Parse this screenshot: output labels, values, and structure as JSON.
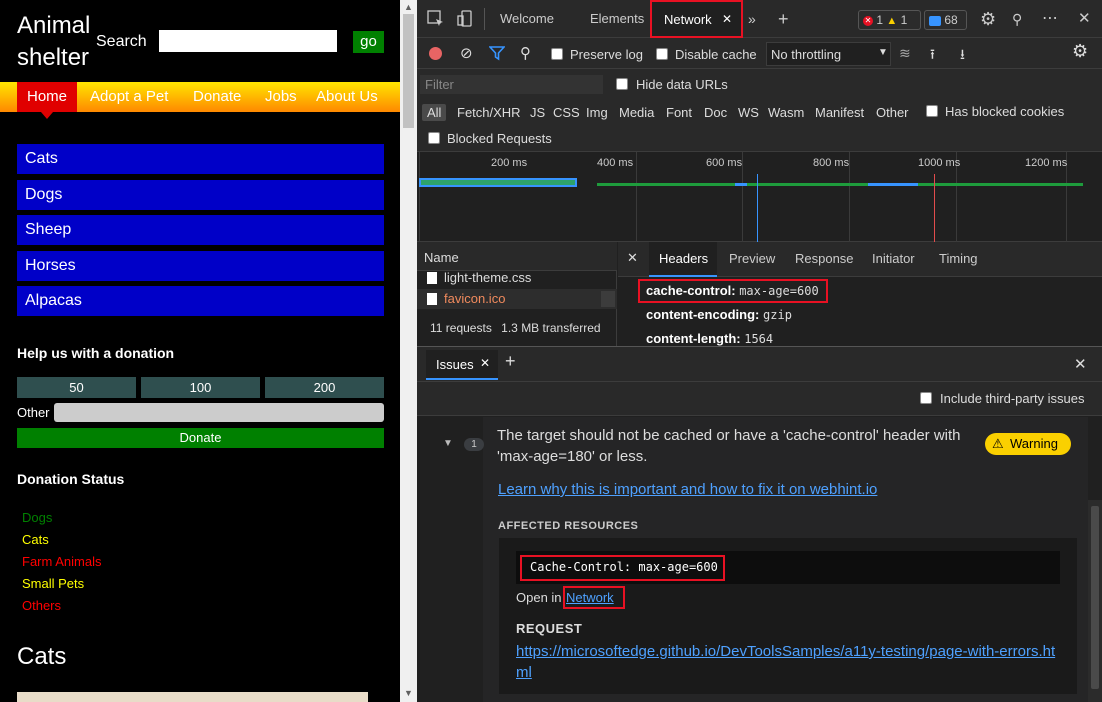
{
  "page": {
    "title": "Animal shelter",
    "search_label": "Search",
    "go_label": "go",
    "nav": [
      "Home",
      "Adopt a Pet",
      "Donate",
      "Jobs",
      "About Us"
    ],
    "animals": [
      "Cats",
      "Dogs",
      "Sheep",
      "Horses",
      "Alpacas"
    ],
    "donation_heading": "Help us with a donation",
    "amounts": [
      "50",
      "100",
      "200"
    ],
    "other_label": "Other",
    "donate_label": "Donate",
    "status_heading": "Donation Status",
    "status_items": [
      {
        "label": "Dogs",
        "color": "#008000"
      },
      {
        "label": "Cats",
        "color": "#ffff00"
      },
      {
        "label": "Farm Animals",
        "color": "#ff0000"
      },
      {
        "label": "Small Pets",
        "color": "#ffff00"
      },
      {
        "label": "Others",
        "color": "#ff0000"
      }
    ],
    "cats_heading": "Cats"
  },
  "devtools": {
    "tabs": {
      "welcome": "Welcome",
      "elements": "Elements",
      "network": "Network"
    },
    "counts": {
      "errors": "1",
      "warnings": "1",
      "messages": "68"
    },
    "toolbar": {
      "preserve_log": "Preserve log",
      "disable_cache": "Disable cache",
      "throttling": "No throttling"
    },
    "filter": {
      "placeholder": "Filter",
      "hide_data_urls": "Hide data URLs",
      "types": [
        "All",
        "Fetch/XHR",
        "JS",
        "CSS",
        "Img",
        "Media",
        "Font",
        "Doc",
        "WS",
        "Wasm",
        "Manifest",
        "Other"
      ],
      "has_blocked_cookies": "Has blocked cookies",
      "blocked_requests": "Blocked Requests"
    },
    "timeline_labels": [
      "200 ms",
      "400 ms",
      "600 ms",
      "800 ms",
      "1000 ms",
      "1200 ms"
    ],
    "requests": {
      "name_header": "Name",
      "items": [
        "light-theme.css",
        "favicon.ico"
      ],
      "summary_requests": "11 requests",
      "summary_transferred": "1.3 MB transferred"
    },
    "detail_tabs": [
      "Headers",
      "Preview",
      "Response",
      "Initiator",
      "Timing"
    ],
    "headers": [
      {
        "key": "cache-control:",
        "value": "max-age=600"
      },
      {
        "key": "content-encoding:",
        "value": "gzip"
      },
      {
        "key": "content-length:",
        "value": "1564"
      }
    ],
    "issues": {
      "tab_label": "Issues",
      "include_third_party": "Include third-party issues",
      "count": "1",
      "message": "The target should not be cached or have a 'cache-control' header with 'max-age=180' or less.",
      "severity": "Warning",
      "learn_link": "Learn why this is important and how to fix it on webhint.io",
      "affected_heading": "AFFECTED RESOURCES",
      "code": "Cache-Control: max-age=600",
      "open_in": "Open in",
      "open_in_link": "Network",
      "request_heading": "REQUEST",
      "request_url": "https://microsoftedge.github.io/DevToolsSamples/a11y-testing/page-with-errors.html"
    }
  }
}
